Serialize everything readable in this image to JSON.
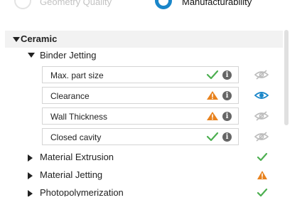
{
  "mode_selector": {
    "options": [
      {
        "label": "Geometry Quality",
        "selected": false
      },
      {
        "label": "Manufacturability",
        "selected": true
      }
    ]
  },
  "tree": {
    "category": {
      "label": "Ceramic",
      "expanded": true,
      "children": [
        {
          "label": "Binder Jetting",
          "expanded": true,
          "checks": [
            {
              "label": "Max. part size",
              "status": "check-icon",
              "visible": false
            },
            {
              "label": "Clearance",
              "status": "warning-icon",
              "visible": true
            },
            {
              "label": "Wall Thickness",
              "status": "warning-icon",
              "visible": false
            },
            {
              "label": "Closed cavity",
              "status": "check-icon",
              "visible": false
            }
          ]
        },
        {
          "label": "Material Extrusion",
          "expanded": false,
          "status": "check-icon"
        },
        {
          "label": "Material Jetting",
          "expanded": false,
          "status": "warning-icon"
        },
        {
          "label": "Photopolymerization",
          "expanded": false,
          "status": "check-icon"
        }
      ]
    }
  },
  "icons": {
    "info_glyph": "i"
  },
  "colors": {
    "accent": "#1a86c9",
    "ok": "#4caf50",
    "warning": "#e8821e",
    "muted": "#c2c2c2",
    "row_highlight": "#f2f2f2"
  }
}
